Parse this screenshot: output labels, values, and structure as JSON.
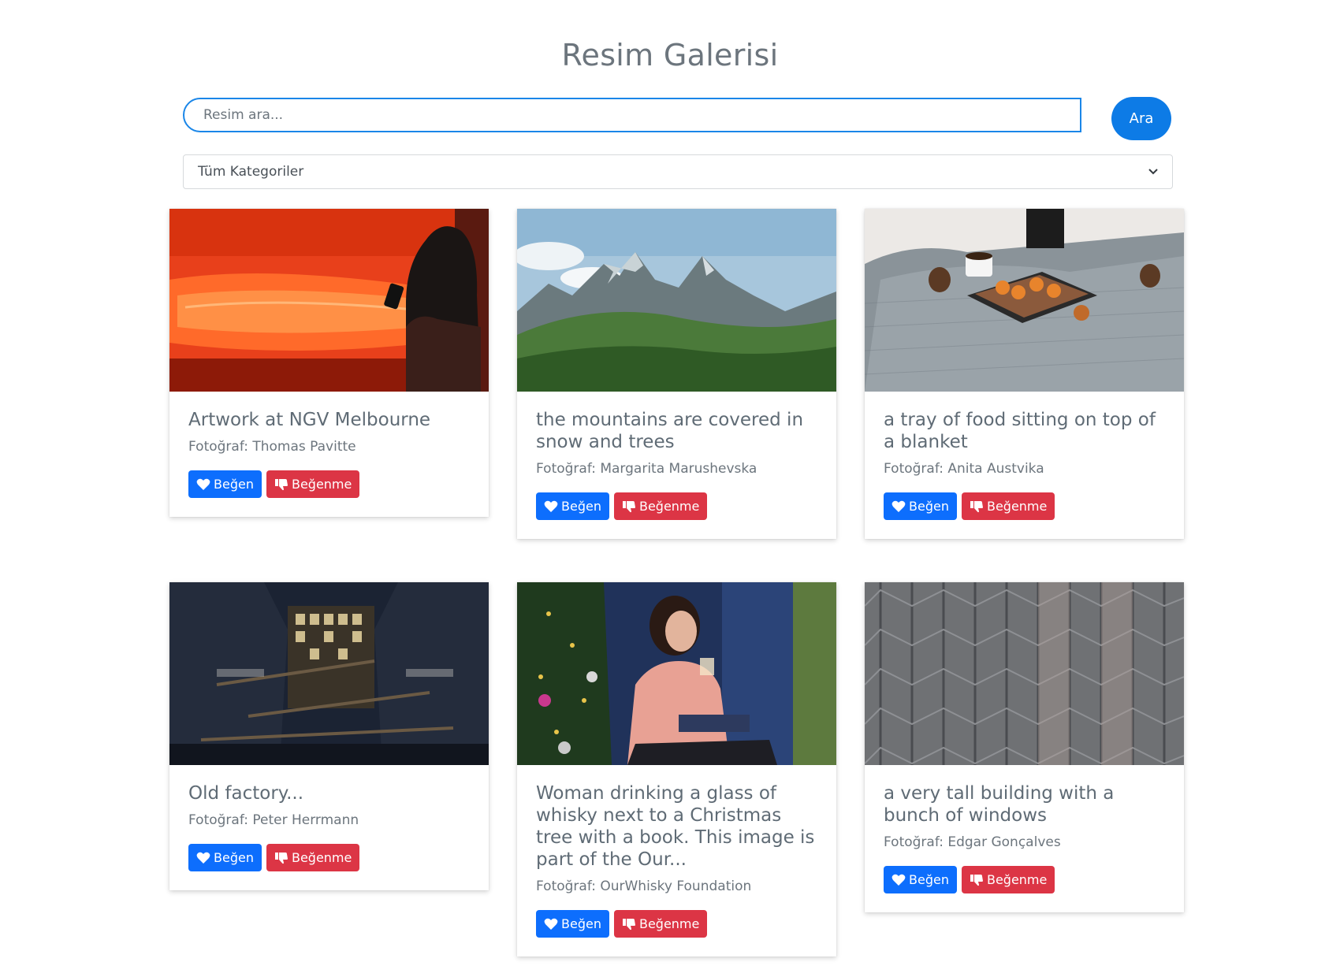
{
  "header": {
    "title": "Resim Galerisi"
  },
  "search": {
    "placeholder": "Resim ara...",
    "value": "",
    "button_label": "Ara"
  },
  "category_filter": {
    "selected": "Tüm Kategoriler"
  },
  "cards": [
    {
      "title": "Artwork at NGV Melbourne",
      "photographer": "Fotoğraf: Thomas Pavitte",
      "like_label": "Beğen",
      "dislike_label": "Beğenme"
    },
    {
      "title": "the mountains are covered in snow and trees",
      "photographer": "Fotoğraf: Margarita Marushevska",
      "like_label": "Beğen",
      "dislike_label": "Beğenme"
    },
    {
      "title": "a tray of food sitting on top of a blanket",
      "photographer": "Fotoğraf: Anita Austvika",
      "like_label": "Beğen",
      "dislike_label": "Beğenme"
    },
    {
      "title": "Old factory...",
      "photographer": "Fotoğraf: Peter Herrmann",
      "like_label": "Beğen",
      "dislike_label": "Beğenme"
    },
    {
      "title": "Woman drinking a glass of whisky next to a Christmas tree with a book. This image is part of the Our...",
      "photographer": "Fotoğraf: OurWhisky Foundation",
      "like_label": "Beğen",
      "dislike_label": "Beğenme"
    },
    {
      "title": "a very tall building with a bunch of windows",
      "photographer": "Fotoğraf: Edgar Gonçalves",
      "like_label": "Beğen",
      "dislike_label": "Beğenme"
    }
  ],
  "colors": {
    "primary": "#0d6efd",
    "danger": "#dc3545",
    "input_border": "#1a86e8",
    "search_button": "#0d7be6"
  },
  "icons": {
    "like": "heart-icon",
    "dislike": "thumbs-down-icon",
    "select": "chevron-down-icon"
  }
}
